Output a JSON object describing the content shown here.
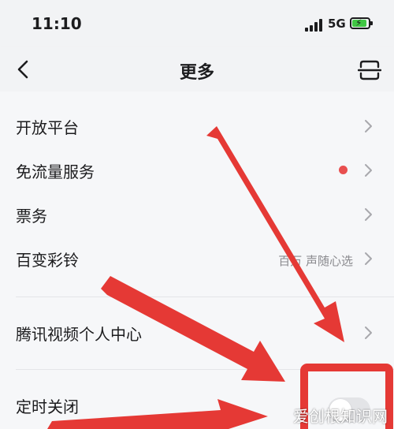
{
  "status_bar": {
    "time": "11:10",
    "network": "5G",
    "battery_color": "#41c744"
  },
  "nav": {
    "title": "更多",
    "back_icon": "chevron-left-icon",
    "right_icon": "scan-icon"
  },
  "menu": {
    "items": [
      {
        "label": "开放平台"
      },
      {
        "label": "免流量服务",
        "badge_color": "#e84f4f"
      },
      {
        "label": "票务"
      },
      {
        "label": "百变彩铃",
        "sub": "百万 声随心选"
      },
      {
        "label": "腾讯视频个人中心"
      },
      {
        "label": "定时关闭",
        "toggle_on": false
      }
    ]
  },
  "annotation": {
    "arrow_color": "#e53935",
    "highlight_color": "#e53935"
  },
  "watermark": {
    "text": "爱创根知识网"
  }
}
